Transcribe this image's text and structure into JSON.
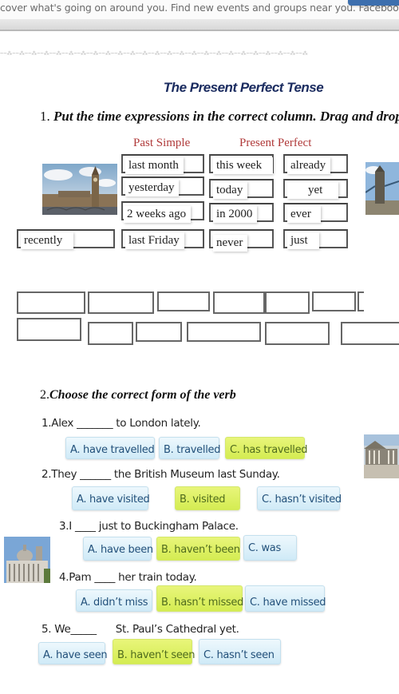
{
  "notification": {
    "text": "cover what's going on around you. Find new events and groups near you. Facebook®"
  },
  "decor_line": "~~⁂~~⁂~~⁂~~⁂~~⁂~~⁂~~⁂~~⁂~~⁂~~⁂~~⁂~~⁂~~⁂~~⁂~~⁂~~⁂~~⁂~~⁂~~⁂~~⁂~~⁂~~⁂~~⁂~~⁂~~⁂",
  "worksheet": {
    "title": "The Present Perfect Tense",
    "task1": {
      "number": "1.",
      "instruction": "Put the time expressions in the correct column. Drag and drop",
      "column_past": "Past Simple",
      "column_present": "Present Perfect",
      "chips": [
        {
          "text": "last month"
        },
        {
          "text": "this week"
        },
        {
          "text": "already"
        },
        {
          "text": "yesterday"
        },
        {
          "text": "today"
        },
        {
          "text": "yet"
        },
        {
          "text": "2 weeks ago"
        },
        {
          "text": "in 2000"
        },
        {
          "text": "ever"
        },
        {
          "text": "recently"
        },
        {
          "text": "last Friday"
        },
        {
          "text": "never"
        },
        {
          "text": "just"
        }
      ],
      "images": [
        "big-ben-photo",
        "tower-bridge-photo"
      ]
    },
    "task2": {
      "number": "2.",
      "instruction": "Choose the correct  form of  the verb",
      "questions": [
        {
          "text": "1.Alex _______  to London lately.",
          "options": [
            {
              "label": "A. have travelled",
              "state": "default"
            },
            {
              "label": "B. travelled",
              "state": "default"
            },
            {
              "label": "C. has travelled",
              "state": "highlighted"
            }
          ]
        },
        {
          "text": "2.They ______ the British Museum last Sunday.",
          "options": [
            {
              "label": "A. have visited",
              "state": "default"
            },
            {
              "label": "B. visited",
              "state": "highlighted"
            },
            {
              "label": "C. hasn’t visited",
              "state": "default"
            }
          ]
        },
        {
          "text": "3.I ____ just  to Buckingham Palace.",
          "options": [
            {
              "label": "A. have been",
              "state": "default"
            },
            {
              "label": "B. haven’t been",
              "state": "highlighted"
            },
            {
              "label": "C. was",
              "state": "default"
            }
          ]
        },
        {
          "text": "4.Pam ____  her train today.",
          "options": [
            {
              "label": "A. didn’t miss",
              "state": "default"
            },
            {
              "label": "B. hasn’t missed",
              "state": "highlighted"
            },
            {
              "label": "C. have missed",
              "state": "default"
            }
          ]
        },
        {
          "text": "5. We_____      St. Paul’s Cathedral yet.",
          "options": [
            {
              "label": "A. have seen",
              "state": "default"
            },
            {
              "label": "B. haven’t seen",
              "state": "highlighted"
            },
            {
              "label": "C. hasn’t seen",
              "state": "default"
            }
          ]
        }
      ]
    }
  },
  "colors": {
    "title": "#1a2b5f",
    "column_heading": "#b03a3a",
    "option_default": "#cfeaf7",
    "option_highlighted": "#d4ec52",
    "facebook_button": "#3d6fae"
  }
}
